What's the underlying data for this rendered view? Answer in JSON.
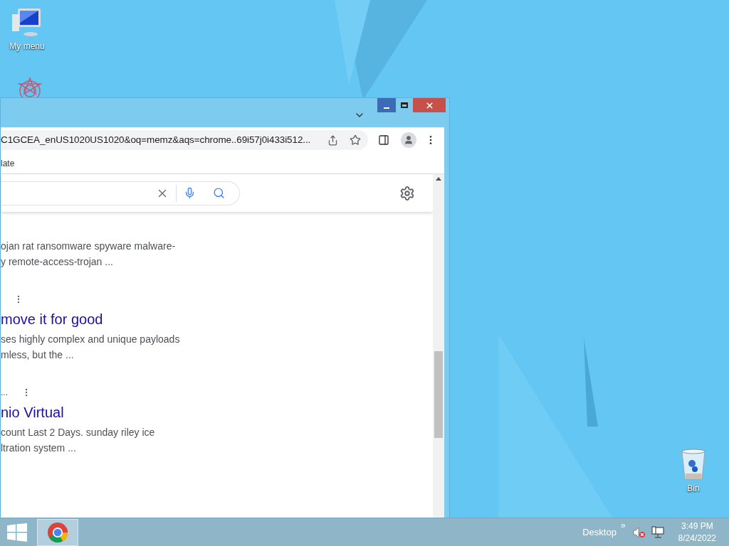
{
  "desktop_icons": [
    {
      "kind": "computer",
      "label": "My menu"
    },
    {
      "kind": "flower"
    },
    {
      "kind": "bin",
      "label": "Bin"
    }
  ],
  "browser": {
    "address": "C1GCEA_enUS1020US1020&oq=memz&aqs=chrome..69i57j0i433i512...",
    "bookmarks": [
      "late"
    ],
    "results": [
      {
        "kind": "snippet",
        "snippet": [
          "ojan rat ransomware spyware malware-",
          "y remote-access-trojan ..."
        ]
      },
      {
        "kind": "result",
        "title": "move it for good",
        "snippet": [
          "ses highly complex and unique payloads",
          "mless, but the ..."
        ]
      },
      {
        "kind": "result",
        "meta": "...",
        "title": "nio Virtual",
        "snippet": [
          "count Last 2 Days. sunday riley ice",
          "ltration system ..."
        ]
      }
    ]
  },
  "taskbar": {
    "toolbar_label": "Desktop",
    "toolbar_chevron": "»",
    "time": "3:49 PM",
    "date": "8/24/2022",
    "apps": [
      {
        "kind": "chrome",
        "selected": true
      }
    ]
  }
}
